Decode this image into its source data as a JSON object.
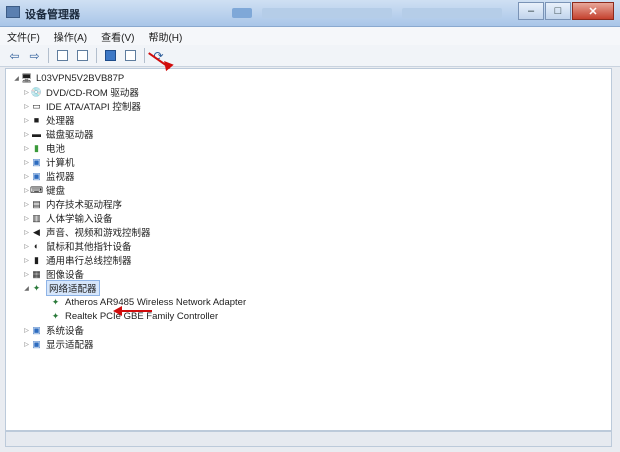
{
  "window": {
    "title": "设备管理器"
  },
  "menu": [
    "文件(F)",
    "操作(A)",
    "查看(V)",
    "帮助(H)"
  ],
  "toolbar": {
    "items": [
      "back-icon",
      "forward-icon",
      "sep",
      "properties-icon",
      "driver-icon",
      "sep",
      "help-icon",
      "view-icon",
      "sep",
      "scan-hardware-icon"
    ]
  },
  "tree": {
    "root": "L03VPN5V2BVB87P",
    "items": [
      {
        "label": "DVD/CD-ROM 驱动器",
        "icon": "dvd-icon"
      },
      {
        "label": "IDE ATA/ATAPI 控制器",
        "icon": "ide-icon"
      },
      {
        "label": "处理器",
        "icon": "cpu-icon"
      },
      {
        "label": "磁盘驱动器",
        "icon": "disk-icon"
      },
      {
        "label": "电池",
        "icon": "battery-icon"
      },
      {
        "label": "计算机",
        "icon": "computer-icon"
      },
      {
        "label": "监视器",
        "icon": "monitor-icon"
      },
      {
        "label": "键盘",
        "icon": "keyboard-icon"
      },
      {
        "label": "内存技术驱动程序",
        "icon": "memory-icon"
      },
      {
        "label": "人体学输入设备",
        "icon": "hid-icon"
      },
      {
        "label": "声音、视频和游戏控制器",
        "icon": "sound-icon"
      },
      {
        "label": "鼠标和其他指针设备",
        "icon": "mouse-icon"
      },
      {
        "label": "通用串行总线控制器",
        "icon": "usb-icon"
      },
      {
        "label": "图像设备",
        "icon": "camera-icon"
      },
      {
        "label": "网络适配器",
        "icon": "network-icon",
        "expanded": true,
        "selected": true,
        "children": [
          {
            "label": "Atheros AR9485 Wireless Network Adapter",
            "icon": "network-adapter-icon"
          },
          {
            "label": "Realtek PCIe GBE Family Controller",
            "icon": "network-adapter-icon"
          }
        ]
      },
      {
        "label": "系统设备",
        "icon": "system-icon"
      },
      {
        "label": "显示适配器",
        "icon": "display-icon"
      }
    ]
  }
}
